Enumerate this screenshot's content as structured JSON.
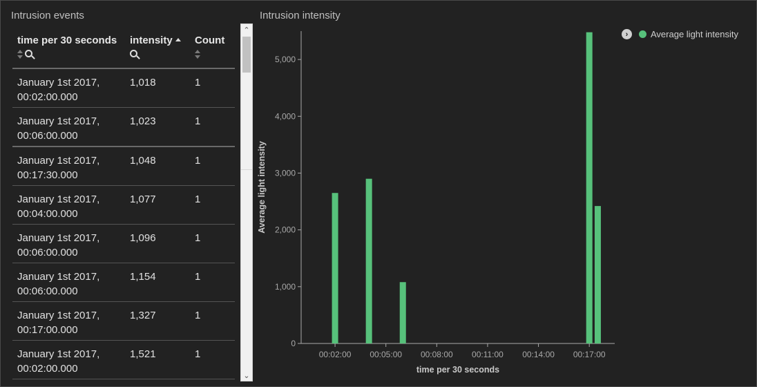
{
  "left_panel": {
    "title": "Intrusion events",
    "columns": [
      "time per 30 seconds",
      "intensity",
      "Count"
    ],
    "rows": [
      {
        "time": "January 1st 2017, 00:02:00.000",
        "intensity": "1,018",
        "count": "1"
      },
      {
        "time": "January 1st 2017, 00:06:00.000",
        "intensity": "1,023",
        "count": "1"
      },
      {
        "time": "January 1st 2017, 00:17:30.000",
        "intensity": "1,048",
        "count": "1"
      },
      {
        "time": "January 1st 2017, 00:04:00.000",
        "intensity": "1,077",
        "count": "1"
      },
      {
        "time": "January 1st 2017, 00:06:00.000",
        "intensity": "1,096",
        "count": "1"
      },
      {
        "time": "January 1st 2017, 00:06:00.000",
        "intensity": "1,154",
        "count": "1"
      },
      {
        "time": "January 1st 2017, 00:17:00.000",
        "intensity": "1,327",
        "count": "1"
      },
      {
        "time": "January 1st 2017, 00:02:00.000",
        "intensity": "1,521",
        "count": "1"
      }
    ]
  },
  "right_panel": {
    "title": "Intrusion intensity"
  },
  "chart_data": {
    "type": "bar",
    "title": "",
    "xlabel": "time per 30 seconds",
    "ylabel": "Average light intensity",
    "series": [
      {
        "name": "Average light intensity",
        "color": "#57c17b",
        "points": [
          {
            "x": "00:02:00",
            "y": 2650
          },
          {
            "x": "00:04:00",
            "y": 2900
          },
          {
            "x": "00:06:00",
            "y": 1080
          },
          {
            "x": "00:17:00",
            "y": 5480
          },
          {
            "x": "00:17:30",
            "y": 2420
          }
        ]
      }
    ],
    "x_ticks": [
      "00:02:00",
      "00:05:00",
      "00:08:00",
      "00:11:00",
      "00:14:00",
      "00:17:00"
    ],
    "x_range_minutes": [
      0.0,
      18.5
    ],
    "y_ticks": [
      "0",
      "1,000",
      "2,000",
      "3,000",
      "4,000",
      "5,000"
    ],
    "ylim": [
      0,
      5500
    ],
    "legend": "top-right",
    "grid": false
  }
}
